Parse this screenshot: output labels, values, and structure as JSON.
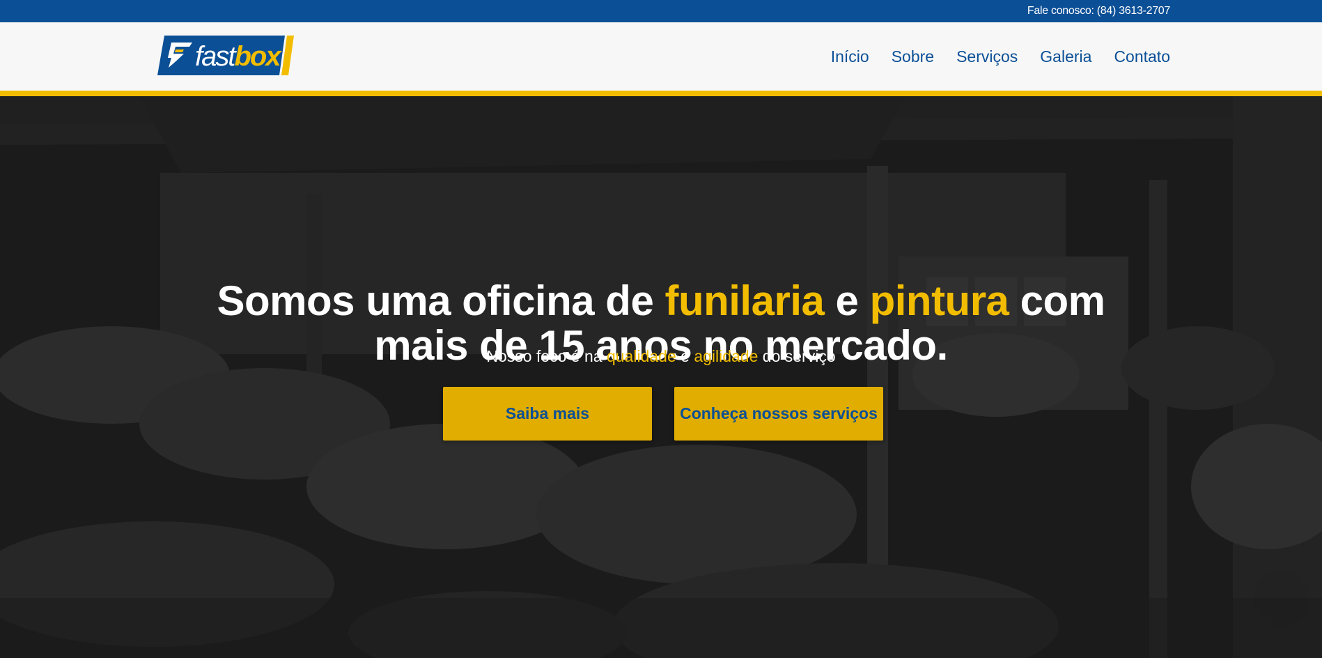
{
  "colors": {
    "brand_blue": "#0b4f96",
    "brand_yellow": "#f2bd00",
    "button_yellow": "#e0ad00",
    "header_bg": "#f7f7f7",
    "hero_overlay": "#1b1b1b"
  },
  "topbar": {
    "contact": "Fale conosco: (84) 3613-2707"
  },
  "logo": {
    "part1": "fast",
    "part2": "box",
    "icon": "lightning-f-icon"
  },
  "nav": {
    "items": [
      "Início",
      "Sobre",
      "Serviços",
      "Galeria",
      "Contato"
    ]
  },
  "hero": {
    "background": "workshop-photo-darkened",
    "title": {
      "part1": "Somos uma oficina de ",
      "highlight1": "funilaria",
      "part2": " e ",
      "highlight2": "pintura",
      "part3": " com",
      "line2": "mais de 15 anos no mercado."
    },
    "subtitle": {
      "part1": "Nosso foco é na ",
      "highlight1": "qualidade",
      "part2": " e ",
      "highlight2": "agilidade",
      "part3": " do serviço"
    },
    "buttons": {
      "primary": "Saiba mais",
      "secondary": "Conheça nossos serviços"
    }
  }
}
